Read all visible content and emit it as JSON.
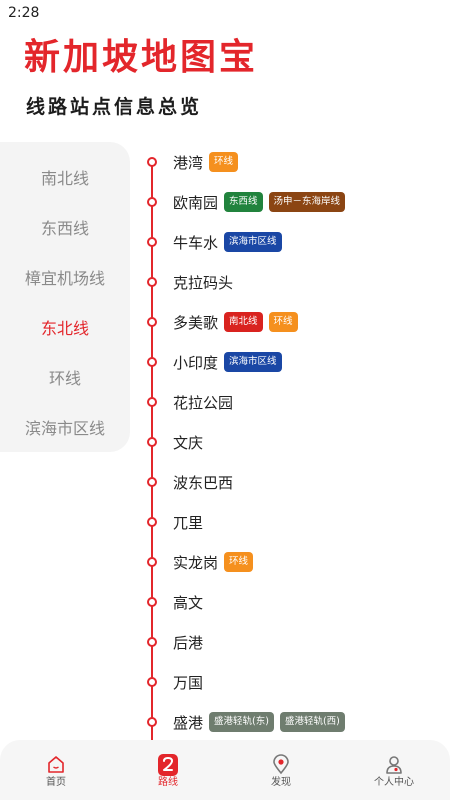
{
  "status_bar": {
    "time": "2:28"
  },
  "header": {
    "title": "新加坡地图宝",
    "subtitle": "线路站点信息总览"
  },
  "sidebar": {
    "items": [
      {
        "label": "南北线",
        "active": false
      },
      {
        "label": "东西线",
        "active": false
      },
      {
        "label": "樟宜机场线",
        "active": false
      },
      {
        "label": "东北线",
        "active": true
      },
      {
        "label": "环线",
        "active": false
      },
      {
        "label": "滨海市区线",
        "active": false
      }
    ]
  },
  "line_color": "#e3262b",
  "stations": [
    {
      "name": "港湾",
      "tags": [
        {
          "label": "环线",
          "color": "#f5901e"
        }
      ]
    },
    {
      "name": "欧南园",
      "tags": [
        {
          "label": "东西线",
          "color": "#21833d"
        },
        {
          "label": "汤申－东海岸线",
          "color": "#8b4513"
        }
      ]
    },
    {
      "name": "牛车水",
      "tags": [
        {
          "label": "滨海市区线",
          "color": "#1a47a5"
        }
      ]
    },
    {
      "name": "克拉码头",
      "tags": []
    },
    {
      "name": "多美歌",
      "tags": [
        {
          "label": "南北线",
          "color": "#d9231f"
        },
        {
          "label": "环线",
          "color": "#f5901e"
        }
      ]
    },
    {
      "name": "小印度",
      "tags": [
        {
          "label": "滨海市区线",
          "color": "#1a47a5"
        }
      ]
    },
    {
      "name": "花拉公园",
      "tags": []
    },
    {
      "name": "文庆",
      "tags": []
    },
    {
      "name": "波东巴西",
      "tags": []
    },
    {
      "name": "兀里",
      "tags": []
    },
    {
      "name": "实龙岗",
      "tags": [
        {
          "label": "环线",
          "color": "#f5901e"
        }
      ]
    },
    {
      "name": "高文",
      "tags": []
    },
    {
      "name": "后港",
      "tags": []
    },
    {
      "name": "万国",
      "tags": []
    },
    {
      "name": "盛港",
      "tags": [
        {
          "label": "盛港轻轨(东)",
          "color": "#6f7d6f"
        },
        {
          "label": "盛港轻轨(西)",
          "color": "#6f7d6f"
        }
      ]
    }
  ],
  "tabbar": {
    "tabs": [
      {
        "label": "首页",
        "icon": "home-icon",
        "active": false
      },
      {
        "label": "路线",
        "icon": "route-icon",
        "active": true
      },
      {
        "label": "发现",
        "icon": "location-pin-icon",
        "active": false
      },
      {
        "label": "个人中心",
        "icon": "user-icon",
        "active": false
      }
    ]
  }
}
